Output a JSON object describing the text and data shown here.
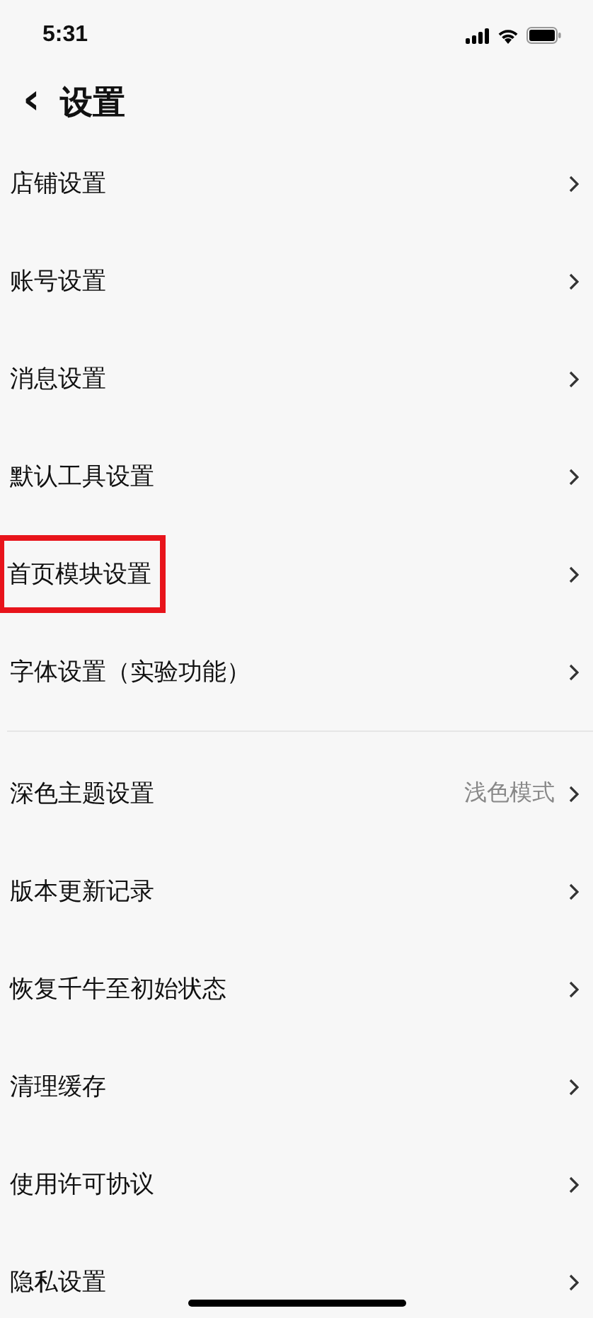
{
  "status_bar": {
    "time": "5:31"
  },
  "nav": {
    "back": "‹",
    "title": "设置"
  },
  "sections": [
    {
      "items": [
        {
          "label": "店铺设置",
          "highlighted": false
        },
        {
          "label": "账号设置",
          "highlighted": false
        },
        {
          "label": "消息设置",
          "highlighted": false
        },
        {
          "label": "默认工具设置",
          "highlighted": false
        },
        {
          "label": "首页模块设置",
          "highlighted": true
        },
        {
          "label": "字体设置（实验功能）",
          "highlighted": false
        }
      ]
    },
    {
      "items": [
        {
          "label": "深色主题设置",
          "value": "浅色模式",
          "highlighted": false
        },
        {
          "label": "版本更新记录",
          "highlighted": false
        },
        {
          "label": "恢复千牛至初始状态",
          "highlighted": false
        },
        {
          "label": "清理缓存",
          "highlighted": false
        },
        {
          "label": "使用许可协议",
          "highlighted": false
        },
        {
          "label": "隐私设置",
          "highlighted": false
        }
      ]
    }
  ]
}
